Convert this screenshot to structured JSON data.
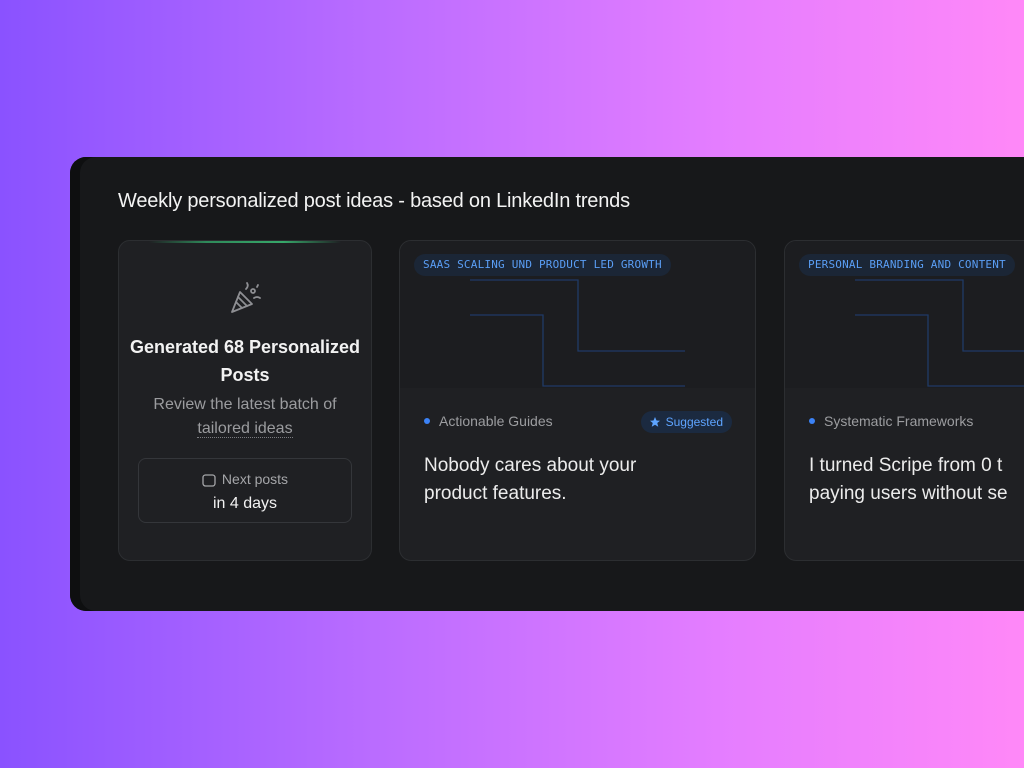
{
  "header": {
    "title": "Weekly personalized post ideas - based on LinkedIn trends"
  },
  "summary_card": {
    "icon": "party-popper-icon",
    "title": "Generated 68 Personalized Posts",
    "subtitle_prefix": "Review the latest batch of",
    "subtitle_link": "tailored ideas",
    "next_label": "Next posts",
    "next_value": "in 4 days",
    "accent_color": "#37a86a"
  },
  "posts": [
    {
      "tag": "SAAS SCALING UND PRODUCT LED GROWTH",
      "category": "Actionable Guides",
      "badge": "Suggested",
      "title_line1": "Nobody cares about your",
      "title_line2": "product features."
    },
    {
      "tag": "PERSONAL BRANDING AND CONTENT",
      "category": "Systematic Frameworks",
      "title_line1": "I turned Scripe from 0 t",
      "title_line2": "paying users without se"
    }
  ],
  "colors": {
    "tag_text": "#5a9ef5",
    "badge_text": "#5ea4ff",
    "category_dot": "#3b82f6"
  }
}
